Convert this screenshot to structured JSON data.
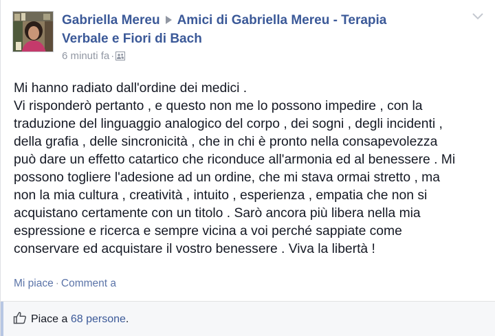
{
  "post": {
    "author": "Gabriella Mereu",
    "target_line1": "Amici di Gabriella Mereu - Terapia",
    "target_line2": "Verbale e Fiori di Bach",
    "timestamp": "6 minuti fa",
    "separator": "·",
    "audience_icon": "friends-icon",
    "body": "Mi hanno radiato dall'ordine dei medici .\nVi risponderò pertanto , e questo non me lo possono impedire , con la\ntraduzione del linguaggio analogico del corpo , dei sogni , degli incidenti ,\ndella grafia , delle sincronicità , che in chi è pronto nella consapevolezza\npuò dare un effetto catartico che riconduce all'armonia ed al benessere . Mi\npossono togliere l'adesione ad un ordine, che mi stava ormai stretto , ma\nnon la mia cultura , creatività , intuito , esperienza , empatia che non si\nacquistano certamente con un titolo . Sarò ancora più libera nella mia\nespressione e ricerca e sempre vicina a voi perché sappiate come\nconservare ed acquistare il vostro benessere . Viva la libertà !"
  },
  "actions": {
    "like_label": "Mi piace",
    "separator": "·",
    "comment_label": "Comment a"
  },
  "likes": {
    "prefix": "Piace a",
    "count_link": "68 persone",
    "suffix": "."
  },
  "colors": {
    "link": "#3b5998",
    "text": "#141823",
    "muted": "#9197a3",
    "bar": "#f6f7f9"
  }
}
